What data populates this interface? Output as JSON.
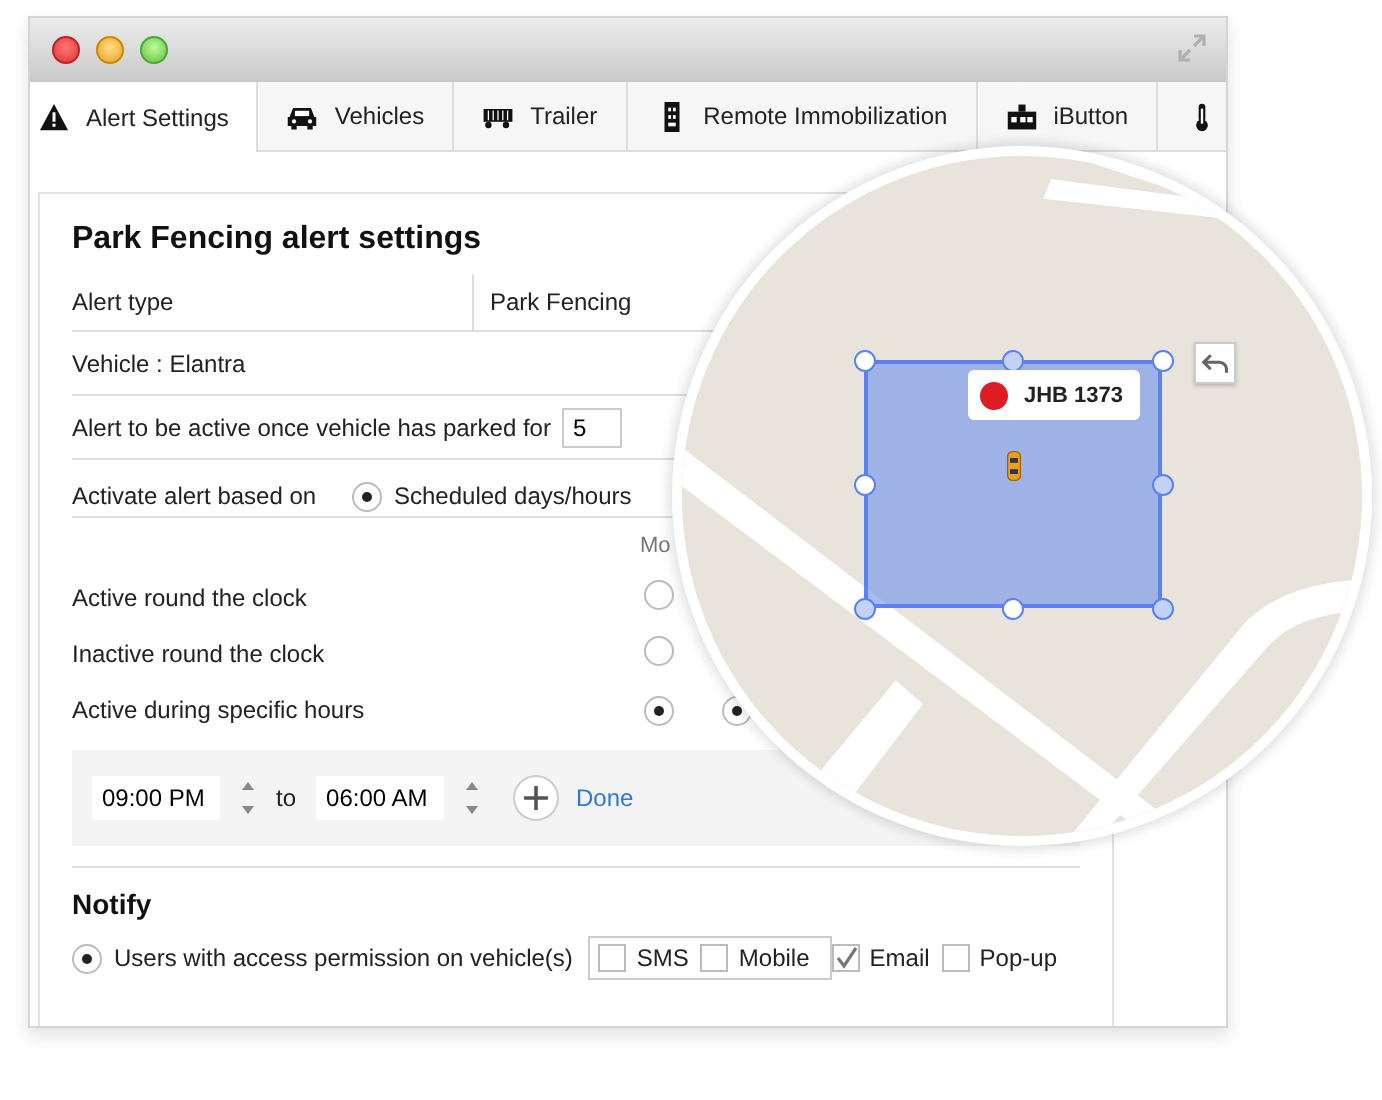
{
  "tabs": [
    {
      "kind": "warning",
      "label": "Alert Settings",
      "selected": true
    },
    {
      "kind": "car",
      "label": "Vehicles",
      "selected": false
    },
    {
      "kind": "trailer",
      "label": "Trailer",
      "selected": false
    },
    {
      "kind": "remote",
      "label": "Remote Immobilization",
      "selected": false
    },
    {
      "kind": "ibutton",
      "label": "iButton",
      "selected": false
    },
    {
      "kind": "thermometer",
      "selected": false
    }
  ],
  "title": "Park Fencing alert settings",
  "alert_type": {
    "label": "Alert type",
    "value": "Park Fencing"
  },
  "vehicle": "Vehicle : Elantra",
  "parked_for": {
    "label": "Alert to be active once vehicle has parked for",
    "value": "5"
  },
  "activate": {
    "label": "Activate alert based on",
    "option": {
      "label": "Scheduled days/hours",
      "selected": true
    }
  },
  "day_header": "Mo",
  "schedule_rows": [
    {
      "label": "Active round the clock",
      "radios": [
        {
          "selected": false
        }
      ]
    },
    {
      "label": "Inactive round the clock",
      "radios": [
        {
          "selected": false
        }
      ]
    },
    {
      "label": "Active during specific hours",
      "radios": [
        {
          "selected": true
        },
        {
          "selected": true
        }
      ]
    }
  ],
  "hours": {
    "from": "09:00 PM",
    "separator": "to",
    "to": "06:00 AM",
    "done": "Done"
  },
  "notify": {
    "title": "Notify",
    "option": {
      "label": "Users with access permission on vehicle(s)",
      "selected": true
    },
    "grouped_channels": [
      {
        "label": "SMS",
        "checked": false
      },
      {
        "label": "Mobile",
        "checked": false
      }
    ],
    "channels": [
      {
        "label": "Email",
        "checked": true
      },
      {
        "label": "Pop-up",
        "checked": false
      }
    ]
  },
  "map": {
    "kind": "picture",
    "marker_label": "JHB 1373"
  }
}
